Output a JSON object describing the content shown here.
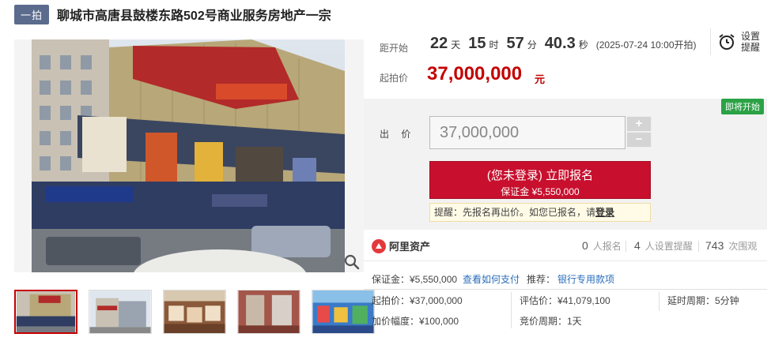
{
  "header": {
    "badge": "一拍",
    "title": "聊城市高唐县鼓楼东路502号商业服务房地产一宗"
  },
  "countdown": {
    "label": "距开始",
    "days": "22",
    "days_unit": "天",
    "hours": "15",
    "hours_unit": "时",
    "minutes": "57",
    "minutes_unit": "分",
    "seconds": "40.3",
    "seconds_unit": "秒",
    "start_time": "(2025-07-24 10:00开拍)",
    "reminder_label": "设置提醒",
    "reminder_icon": "alarm-clock-icon"
  },
  "start_price": {
    "label": "起拍价",
    "value": "37,000,000",
    "unit": "元"
  },
  "bid": {
    "status_badge": "即将开始",
    "label": "出 价",
    "value": "37,000,000",
    "plus": "+",
    "minus": "−",
    "register_label": "(您未登录) 立即报名",
    "deposit_label": "保证金 ¥5,550,000",
    "tip_text": "提醒：先报名再出价。如您已报名，请",
    "tip_link": "登录"
  },
  "stats": {
    "brand": "阿里资产",
    "signups": "0",
    "signups_label": "人报名",
    "reminders": "4",
    "reminders_label": "人设置提醒",
    "views": "743",
    "views_label": "次围观"
  },
  "details": {
    "deposit": "保证金：¥5,550,000",
    "how_to_pay": "查看如何支付",
    "recommend_label": "推荐：",
    "bank_link": "银行专用款项",
    "start_price": "起拍价：¥37,000,000",
    "appraisal": "评估价：¥41,079,100",
    "extension": "延时周期：5分钟",
    "increment": "加价幅度：¥100,000",
    "bid_cycle": "竞价周期：1天"
  },
  "colors": {
    "accent_red": "#c8102e",
    "price_red": "#c40000",
    "link_blue": "#2a6ebb",
    "badge_green": "#2ba245"
  }
}
